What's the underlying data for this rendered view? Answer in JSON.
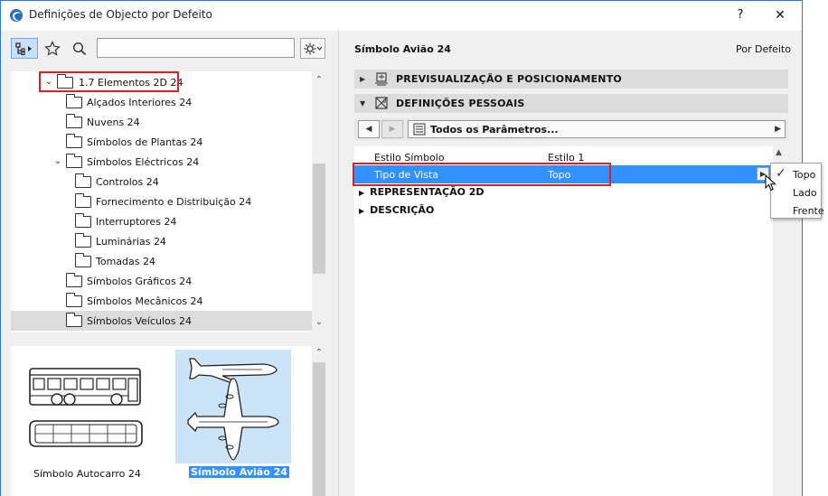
{
  "window": {
    "title": "Definições de Objecto por Defeito",
    "help_label": "?",
    "close_label": "✕"
  },
  "tree": {
    "items": [
      {
        "label": "1.7 Elementos 2D 24",
        "expanded": true,
        "highlighted": true
      },
      {
        "label": "Alçados Interiores 24"
      },
      {
        "label": "Nuvens 24"
      },
      {
        "label": "Símbolos de Plantas 24"
      },
      {
        "label": "Símbolos Eléctricos 24",
        "expanded": true
      },
      {
        "label": "Controlos 24"
      },
      {
        "label": "Fornecimento e Distribuição 24"
      },
      {
        "label": "Interruptores 24"
      },
      {
        "label": "Luminárias 24"
      },
      {
        "label": "Tomadas 24"
      },
      {
        "label": "Símbolos Gráficos 24"
      },
      {
        "label": "Símbolos Mecânicos 24"
      },
      {
        "label": "Símbolos Veículos 24",
        "selected": true
      }
    ]
  },
  "preview": {
    "items": [
      {
        "label": "Símbolo Autocarro 24"
      },
      {
        "label": "Símbolo Avião 24",
        "selected": true
      }
    ]
  },
  "right": {
    "title": "Símbolo Avião 24",
    "default_label": "Por Defeito",
    "sections": [
      {
        "label": "PREVISUALIZAÇÃO E POSICIONAMENTO",
        "expanded": false
      },
      {
        "label": "DEFINIÇÕES PESSOAIS",
        "expanded": true
      }
    ],
    "param_nav": {
      "label": "Todos os Parâmetros..."
    },
    "params": [
      {
        "key": "Estilo Símbolo",
        "value": "Estilo 1"
      },
      {
        "key": "Tipo de Vista",
        "value": "Topo",
        "selected": true
      }
    ],
    "groups": [
      {
        "label": "REPRESENTAÇÃO 2D"
      },
      {
        "label": "DESCRIÇÃO"
      }
    ]
  },
  "popup": {
    "options": [
      {
        "label": "Topo",
        "checked": true
      },
      {
        "label": "Lado"
      },
      {
        "label": "Frente"
      }
    ]
  },
  "colors": {
    "selection": "#3390ff",
    "highlight_box": "#e02020",
    "preview_selected_bg": "#cce4f7"
  }
}
